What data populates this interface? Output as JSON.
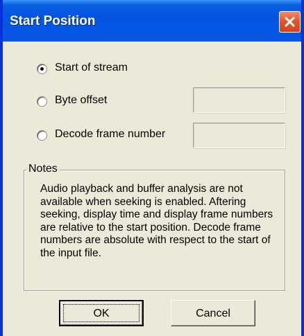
{
  "window": {
    "title": "Start Position"
  },
  "options": [
    {
      "label": "Start of stream",
      "selected": true
    },
    {
      "label": "Byte offset",
      "selected": false
    },
    {
      "label": "Decode frame number",
      "selected": false
    }
  ],
  "inputs": {
    "byte_offset_value": "",
    "frame_number_value": ""
  },
  "notes": {
    "label": "Notes",
    "text": "Audio playback and buffer analysis are not available when seeking is enabled.  Aftering seeking, display time and display frame numbers are relative to the start position.  Decode frame numbers are absolute with respect to the start of the input file."
  },
  "buttons": {
    "ok": "OK",
    "cancel": "Cancel"
  },
  "icons": {
    "close": "close-icon"
  },
  "colors": {
    "title_bar": "#0454e0",
    "dialog_bg": "#ece9d8",
    "close_button": "#e4572e"
  }
}
